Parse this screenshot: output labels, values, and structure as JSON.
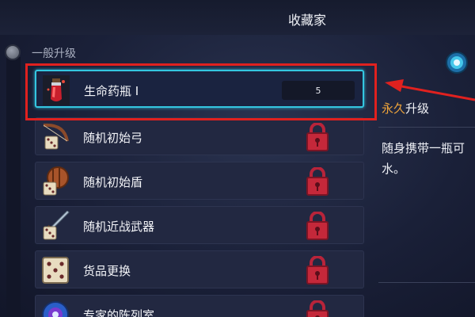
{
  "header": {
    "title": "收藏家"
  },
  "section": {
    "label": "一般升级"
  },
  "items": [
    {
      "label": "生命药瓶 Ⅰ",
      "count": "5",
      "icon": "health-potion-icon",
      "locked": false,
      "selected": true
    },
    {
      "label": "随机初始弓",
      "icon": "random-bow-icon",
      "locked": true,
      "selected": false
    },
    {
      "label": "随机初始盾",
      "icon": "random-shield-icon",
      "locked": true,
      "selected": false
    },
    {
      "label": "随机近战武器",
      "icon": "random-melee-weapon-icon",
      "locked": true,
      "selected": false
    },
    {
      "label": "货品更换",
      "icon": "dice-icon",
      "locked": true,
      "selected": false
    },
    {
      "label": "专家的陈列室",
      "icon": "orb-icon",
      "locked": true,
      "selected": false
    }
  ],
  "detail": {
    "type_accent": "永久",
    "type_rest": "升级",
    "description": "随身携带一瓶可\n水。"
  },
  "colors": {
    "highlight": "#e0211f",
    "selection": "#34c6e0",
    "accent": "#f0a53a",
    "lock": "#c4283a"
  }
}
